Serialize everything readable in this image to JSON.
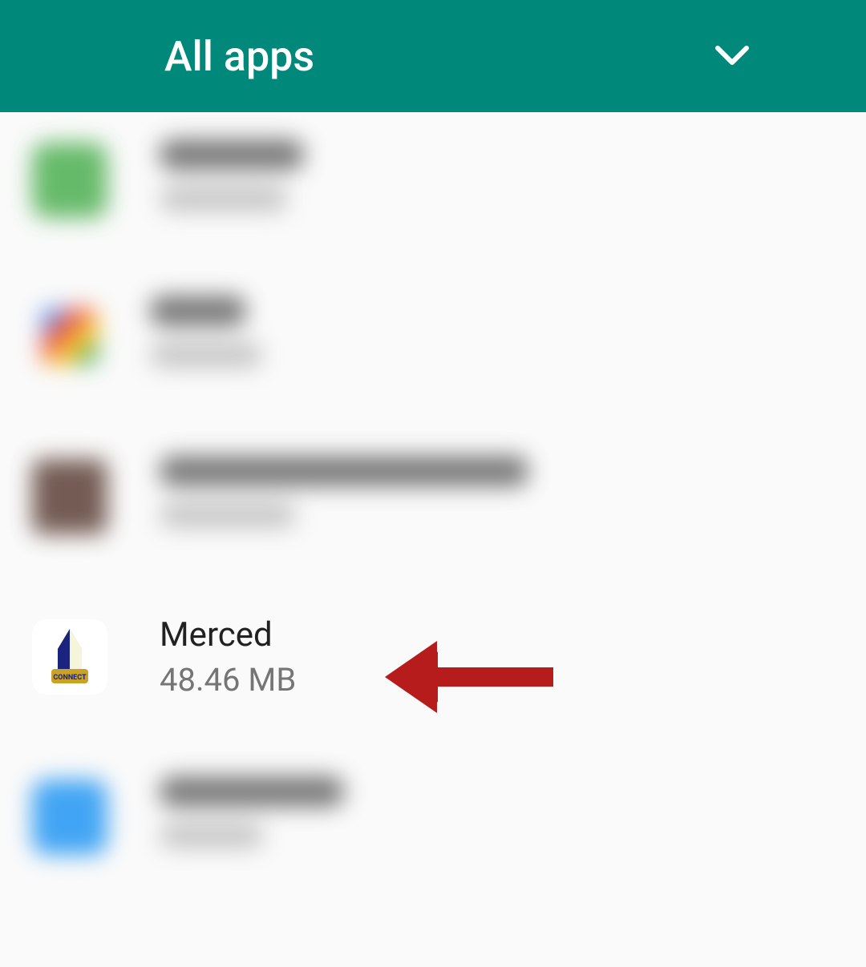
{
  "header": {
    "title": "All apps"
  },
  "apps": [
    {
      "name": "",
      "size": "",
      "blurred": true,
      "icon_type": "green"
    },
    {
      "name": "",
      "size": "",
      "blurred": true,
      "icon_type": "multi"
    },
    {
      "name": "",
      "size": "",
      "blurred": true,
      "icon_type": "brown"
    },
    {
      "name": "Merced",
      "size": "48.46 MB",
      "blurred": false,
      "icon_type": "merced",
      "icon_label": "CONNECT"
    },
    {
      "name": "",
      "size": "",
      "blurred": true,
      "icon_type": "blue"
    }
  ]
}
